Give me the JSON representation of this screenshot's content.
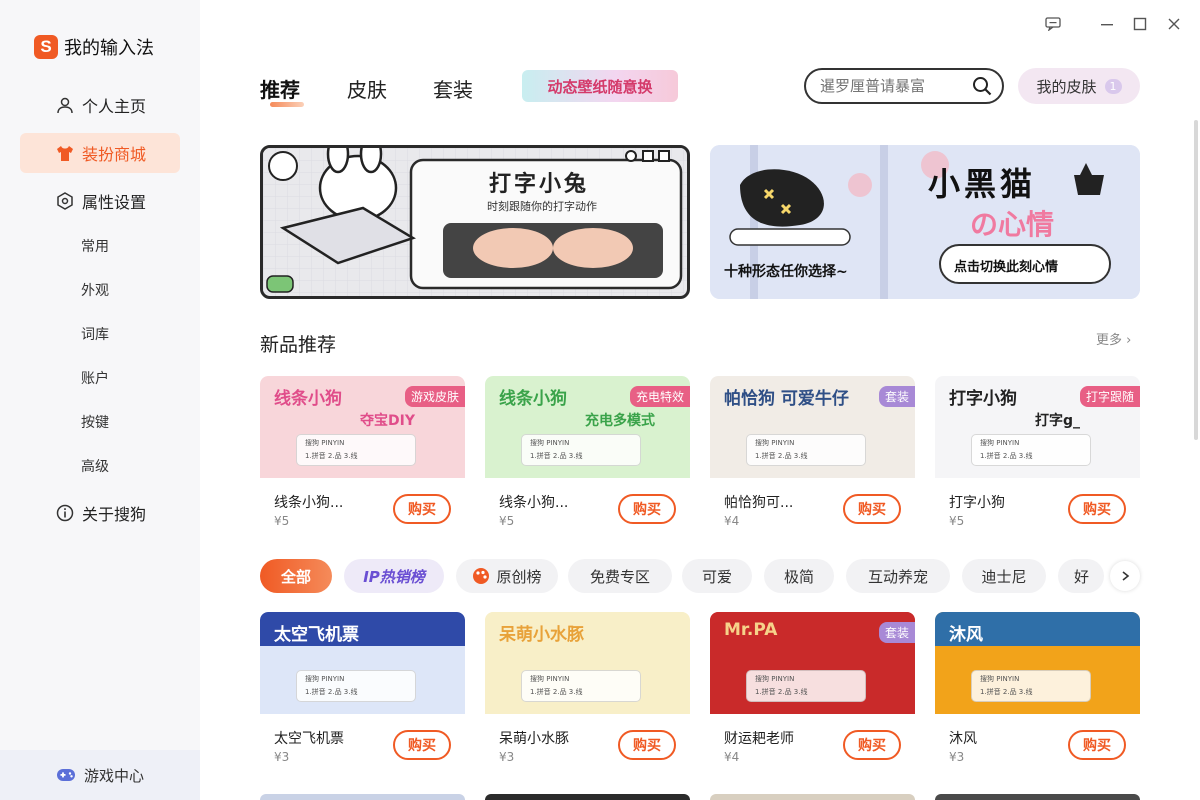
{
  "app": {
    "title": "我的输入法",
    "logo_letter": "S"
  },
  "sidebar": {
    "items": [
      {
        "label": "个人主页",
        "icon": "person-icon"
      },
      {
        "label": "装扮商城",
        "icon": "shirt-icon",
        "active": true
      },
      {
        "label": "属性设置",
        "icon": "settings-icon"
      }
    ],
    "sub_items": [
      "常用",
      "外观",
      "词库",
      "账户",
      "按键",
      "高级"
    ],
    "about": {
      "label": "关于搜狗",
      "icon": "info-icon"
    },
    "game_center": {
      "label": "游戏中心",
      "icon": "gamepad-icon"
    }
  },
  "tabs": [
    {
      "label": "推荐",
      "active": true
    },
    {
      "label": "皮肤"
    },
    {
      "label": "套装"
    }
  ],
  "promo_tab": {
    "label": "动态壁纸随意换"
  },
  "search": {
    "placeholder": "暹罗厘普请暴富"
  },
  "my_skin": {
    "label": "我的皮肤",
    "count": "1"
  },
  "banners": [
    {
      "title": "打字小兔",
      "subtitle": "时刻跟随你的打字动作"
    },
    {
      "title": "小黑猫",
      "title2": "の心情",
      "tagline": "十种形态任你选择~",
      "button": "点击切换此刻心情"
    }
  ],
  "new_section": {
    "title": "新品推荐",
    "more": "更多"
  },
  "new_cards": [
    {
      "name": "线条小狗...",
      "price": "¥5",
      "tag": "游戏皮肤",
      "tag_color": "#e85f85",
      "bg": "#f8d6da",
      "art": "线条小狗",
      "art2": "夺宝DIY",
      "art_color": "#e04d8a"
    },
    {
      "name": "线条小狗...",
      "price": "¥5",
      "tag": "充电特效",
      "tag_color": "#e85f85",
      "bg": "#d9f2cf",
      "art": "线条小狗",
      "art2": "充电多模式",
      "art_color": "#3aa34a"
    },
    {
      "name": "帕恰狗可...",
      "price": "¥4",
      "tag": "套装",
      "tag_color": "#a889d6",
      "bg": "#f1ece6",
      "art": "帕恰狗 可爱牛仔",
      "art2": "",
      "art_color": "#2f4f86"
    },
    {
      "name": "打字小狗",
      "price": "¥5",
      "tag": "打字跟随",
      "tag_color": "#e85f85",
      "bg": "#f5f5f7",
      "art": "打字小狗",
      "art2": "打字g_",
      "art_color": "#222"
    }
  ],
  "filters": [
    "全部",
    "IP热销榜",
    "原创榜",
    "免费专区",
    "可爱",
    "极简",
    "互动养宠",
    "迪士尼",
    "好"
  ],
  "grid_cards": [
    {
      "name": "太空飞机票",
      "price": "¥3",
      "tag": "",
      "bg": "#dde6f8",
      "art": "太空飞机票",
      "art_color": "#ffffff",
      "header_bg": "#2f4aa8"
    },
    {
      "name": "呆萌小水豚",
      "price": "¥3",
      "tag": "",
      "bg": "#f8efc8",
      "art": "呆萌小水豚",
      "art_color": "#e8a23a",
      "header_bg": "#f8efc8"
    },
    {
      "name": "财运耙老师",
      "price": "¥4",
      "tag": "套装",
      "bg": "#c92a2a",
      "art": "Mr.PA",
      "art_color": "#f6d28a",
      "header_bg": "#c92a2a"
    },
    {
      "name": "沐风",
      "price": "¥3",
      "tag": "",
      "bg": "#f2a31a",
      "art": "沐风",
      "art_color": "#ffffff",
      "header_bg": "#2f6fa8"
    }
  ],
  "buy_label": "购买",
  "keyboard_labels": {
    "brand": "搜狗 PINYIN",
    "modes": "1.拼音 2.品 3.线"
  }
}
